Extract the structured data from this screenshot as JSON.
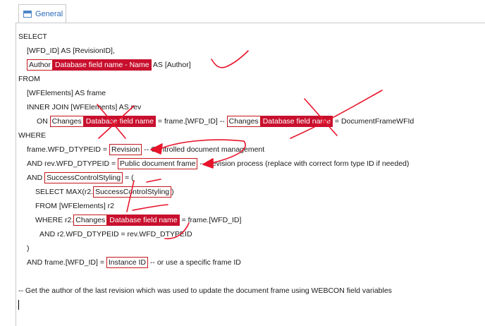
{
  "tab": {
    "label": "General",
    "icon": "window-icon"
  },
  "code": {
    "l1": "SELECT",
    "l2": "[WFD_ID] AS [RevisionID],",
    "l3": {
      "var_label": "Author",
      "var_value": "Database field name - Name",
      "tail": " AS [Author]"
    },
    "l4": "FROM",
    "l5": "[WFElements] AS frame",
    "l6": "INNER JOIN [WFElements] AS rev",
    "l7": {
      "pre": "ON ",
      "var1_label": "Changes",
      "var1_value": "Database field name",
      "mid": " = frame.[WFD_ID] -- ",
      "var2_label": "Changes",
      "var2_value": "Database field name",
      "tail": " = DocumentFrameWFId"
    },
    "l8": "WHERE",
    "l9": {
      "pre": "frame.WFD_DTYPEID = ",
      "var_label": "Revision",
      "tail": " -- Controlled document management"
    },
    "l10": {
      "pre": "AND rev.WFD_DTYPEID = ",
      "var_label": "Public document frame",
      "tail": " -- Revision process (replace with correct form type ID if needed)"
    },
    "l11": {
      "pre": "AND ",
      "var_label": "SuccessControlStyling",
      "tail": " = ("
    },
    "l12": {
      "pre": "SELECT MAX(r2.",
      "var_label": "SuccessControlStyling",
      "tail": ")"
    },
    "l13": "FROM [WFElements] r2",
    "l14": {
      "pre": "WHERE r2.",
      "var_label": "Changes",
      "var_value": "Database field name",
      "tail": " = frame.[WFD_ID]"
    },
    "l15": "AND r2.WFD_DTYPEID = rev.WFD_DTYPEID",
    "l16": ")",
    "l17": {
      "pre": "AND frame.[WFD_ID] = ",
      "var_label": "Instance ID",
      "tail": " -- or use a specific frame ID"
    },
    "l18": "-- Get the author of the last revision which was used to update the document frame using WEBCON field variables"
  },
  "colors": {
    "variable_fill": "#c8102e",
    "variable_border": "#c4161c",
    "annotation": "#e8132a",
    "tab_text": "#2a6ab8"
  }
}
